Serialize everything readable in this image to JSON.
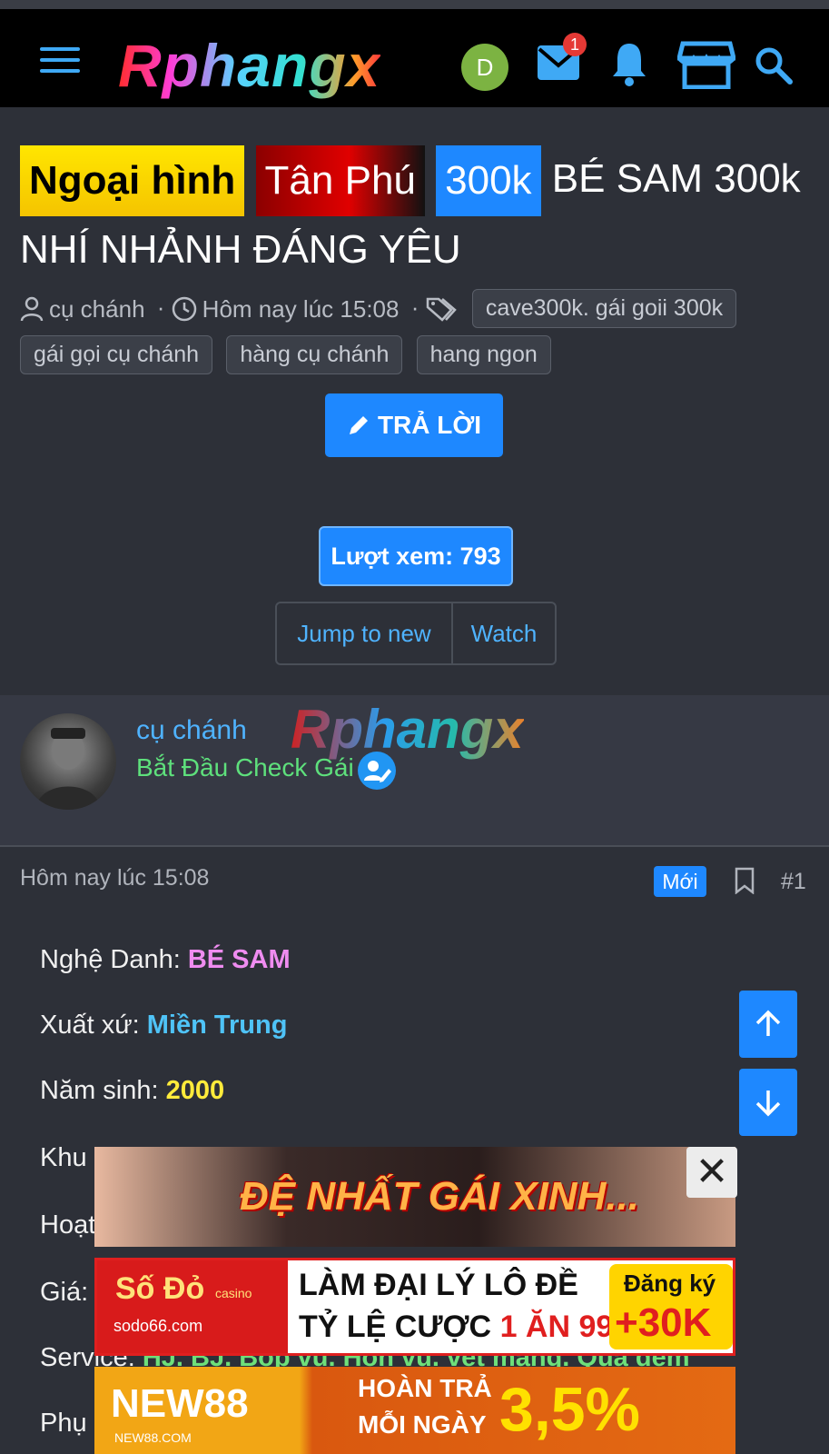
{
  "header": {
    "logo": "Rphangx",
    "avatar_letter": "D",
    "mail_badge": "1",
    "colors": {
      "accent": "#1e88ff",
      "icon": "#3fa9f5",
      "avatar": "#7cb342"
    }
  },
  "thread": {
    "label_1": "Ngoại hình",
    "label_2": "Tân Phú",
    "label_3": "300k",
    "title_rest": "BÉ SAM 300k NHÍ NHẢNH ĐÁNG YÊU",
    "author": "cụ chánh",
    "sep": "·",
    "date": "Hôm nay lúc 15:08",
    "tags": [
      "cave300k. gái goii 300k",
      "gái gọi cụ chánh",
      "hàng cụ chánh",
      "hang ngon"
    ],
    "reply_label": "TRẢ LỜI",
    "views": "Lượt xem: 793",
    "jump_label": "Jump to new",
    "watch_label": "Watch"
  },
  "post": {
    "username": "cụ chánh",
    "watermark": "Rphangx",
    "rank": "Bắt Đầu Check Gái",
    "date": "Hôm nay lúc 15:08",
    "new_badge": "Mới",
    "number": "#1",
    "fields": {
      "stage_label": "Nghệ Danh:",
      "stage_value": "BÉ SAM",
      "origin_label": "Xuất xứ:",
      "origin_value": "Miền Trung",
      "year_label": "Năm sinh:",
      "year_value": "2000",
      "area_label": "Khu",
      "activity_label": "Hoạt",
      "price_label": "Giá:",
      "service_label": "Service:",
      "service_value": "HJ. BJ. Bop vu. Hon vu. vet mang. Qua dem",
      "extra_label": "Phụ"
    }
  },
  "ads": {
    "ad1_text": "ĐỆ NHẤT GÁI XINH...",
    "close": "✕",
    "ad2_brand": "Số Đỏ",
    "ad2_brand_sub": "casino",
    "ad2_url": "sodo66.com",
    "ad2_line1": "LÀM ĐẠI LÝ LÔ ĐỀ",
    "ad2_line2a": "TỶ LỆ CƯỢC ",
    "ad2_line2b": "1 ĂN 99.5",
    "ad2_cta1": "Đăng ký",
    "ad2_cta2": "+30K",
    "ad3_brand": "NEW88",
    "ad3_url": "NEW88.COM",
    "ad3_line1": "HOÀN TRẢ",
    "ad3_line2": "MỖI NGÀY",
    "ad3_pct": "3,5%"
  }
}
